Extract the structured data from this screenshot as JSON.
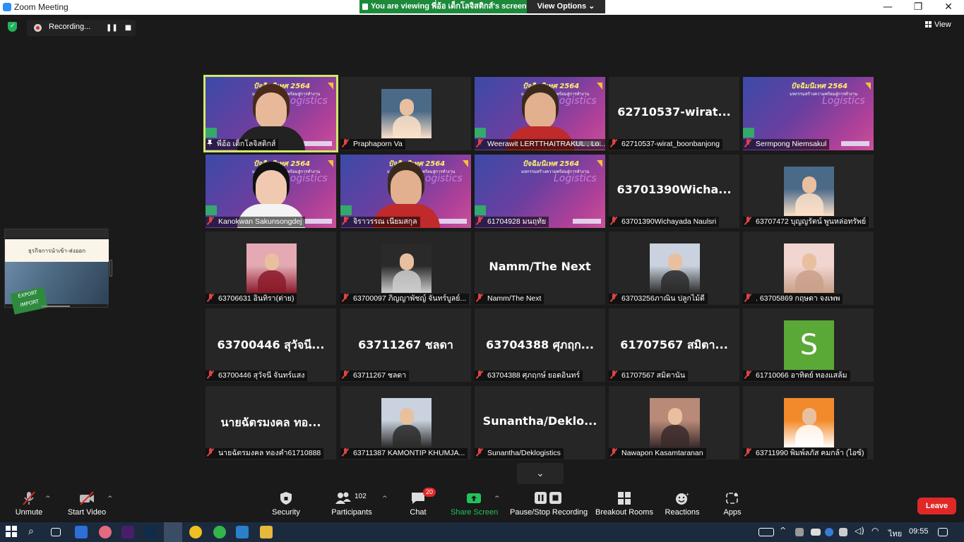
{
  "window": {
    "title": "Zoom Meeting",
    "minimize": "—",
    "maximize": "❐",
    "close": "✕"
  },
  "banner": {
    "viewing_text": "You are viewing พี่อ้อ เด็กโลจิสติกส์'s screen",
    "view_options": "View Options ⌄"
  },
  "recording": {
    "label": "Recording...",
    "pause": "❚❚",
    "stop": "■"
  },
  "view_label": "View",
  "share_thumb": {
    "slide_title": "ธุรกิจการนำเข้า-ส่งออก",
    "sign_top": "EXPORT",
    "sign_bottom": "IMPORT"
  },
  "banner_art": {
    "title": "ปัจฉิมนิเทศ 2564",
    "subtitle": "มหกรรมสร้างความพร้อมสู่การทำงาน",
    "logistics": "Logistics"
  },
  "tiles": [
    {
      "label": "พี่อ้อ เด็กโลจิสติกส์",
      "big": "",
      "kind": "video-banner",
      "active": true,
      "pinned": true
    },
    {
      "label": "Praphaporn Va",
      "big": "",
      "kind": "photo"
    },
    {
      "label": "Weerawit LERTTHAITRAKUL , Lo...",
      "big": "",
      "kind": "video-banner"
    },
    {
      "label": "62710537-wirat_boonbanjong",
      "big": "62710537-wirat...",
      "kind": "name"
    },
    {
      "label": "Sermpong Niemsakul",
      "big": "",
      "kind": "banner"
    },
    {
      "label": "Kanokwan Sakunsongdej",
      "big": "",
      "kind": "video-banner"
    },
    {
      "label": "จิราวรรณ เนียมสกุล",
      "big": "",
      "kind": "video-banner"
    },
    {
      "label": "61704928 มนฤทัย",
      "big": "",
      "kind": "banner"
    },
    {
      "label": "63701390Wichayada Naulsri",
      "big": "63701390Wicha...",
      "kind": "name"
    },
    {
      "label": "63707472 บุญญรัตน์ พูนหล่อทรัพย์",
      "big": "",
      "kind": "photo"
    },
    {
      "label": "63706631 อินทิรา(ต่าย)",
      "big": "",
      "kind": "photo"
    },
    {
      "label": "63700097 ภิญญาพัชญ์ จันทร์บูลย์...",
      "big": "",
      "kind": "photo"
    },
    {
      "label": "Namm/The Next",
      "big": "Namm/The Next",
      "kind": "name"
    },
    {
      "label": "63703256ภาณิน ปลูกไม้ดี",
      "big": "",
      "kind": "photo"
    },
    {
      "label": ". 63705869 กฤษดา จงเพพ",
      "big": "",
      "kind": "photo"
    },
    {
      "label": "63700446 สุวัจนี จันทร์แสง",
      "big": "63700446 สุวัจนี...",
      "kind": "name"
    },
    {
      "label": "63711267 ชลดา",
      "big": "63711267 ชลดา",
      "kind": "name"
    },
    {
      "label": "63704388 ศุภฤกษ์ ยอดอินทร์",
      "big": "63704388 ศุภฤก...",
      "kind": "name"
    },
    {
      "label": "61707567 สมิตานัน",
      "big": "61707567 สมิตา...",
      "kind": "name"
    },
    {
      "label": "61710066 อาทิตย์ ทองแสล้ม",
      "big": "S",
      "kind": "letter"
    },
    {
      "label": "นายฉัตรมงคล ทองคำ61710888",
      "big": "นายฉัตรมงคล ทอ...",
      "kind": "name"
    },
    {
      "label": "63711387 KAMONTIP KHUMJA...",
      "big": "",
      "kind": "photo"
    },
    {
      "label": "Sunantha/Deklogistics",
      "big": "Sunantha/Deklo...",
      "kind": "name"
    },
    {
      "label": "Nawapon Kasamtaranan",
      "big": "",
      "kind": "photo"
    },
    {
      "label": "63711990 พิมพ์ลภัส คมกล้า (ไอซ์)",
      "big": "",
      "kind": "photo"
    }
  ],
  "toolbar": {
    "unmute": "Unmute",
    "start_video": "Start Video",
    "security": "Security",
    "participants": "Participants",
    "participants_count": "102",
    "chat": "Chat",
    "chat_badge": "20",
    "share_screen": "Share Screen",
    "pause_recording": "Pause/Stop Recording",
    "breakout": "Breakout Rooms",
    "reactions": "Reactions",
    "apps": "Apps",
    "leave": "Leave"
  },
  "taskbar": {
    "lang": "ไทย",
    "time": "09:55"
  },
  "colors": {
    "accent_green": "#1c8a3a",
    "leave_red": "#e02828",
    "active_speaker": "#d3e76a",
    "share_green": "#22c25a"
  }
}
